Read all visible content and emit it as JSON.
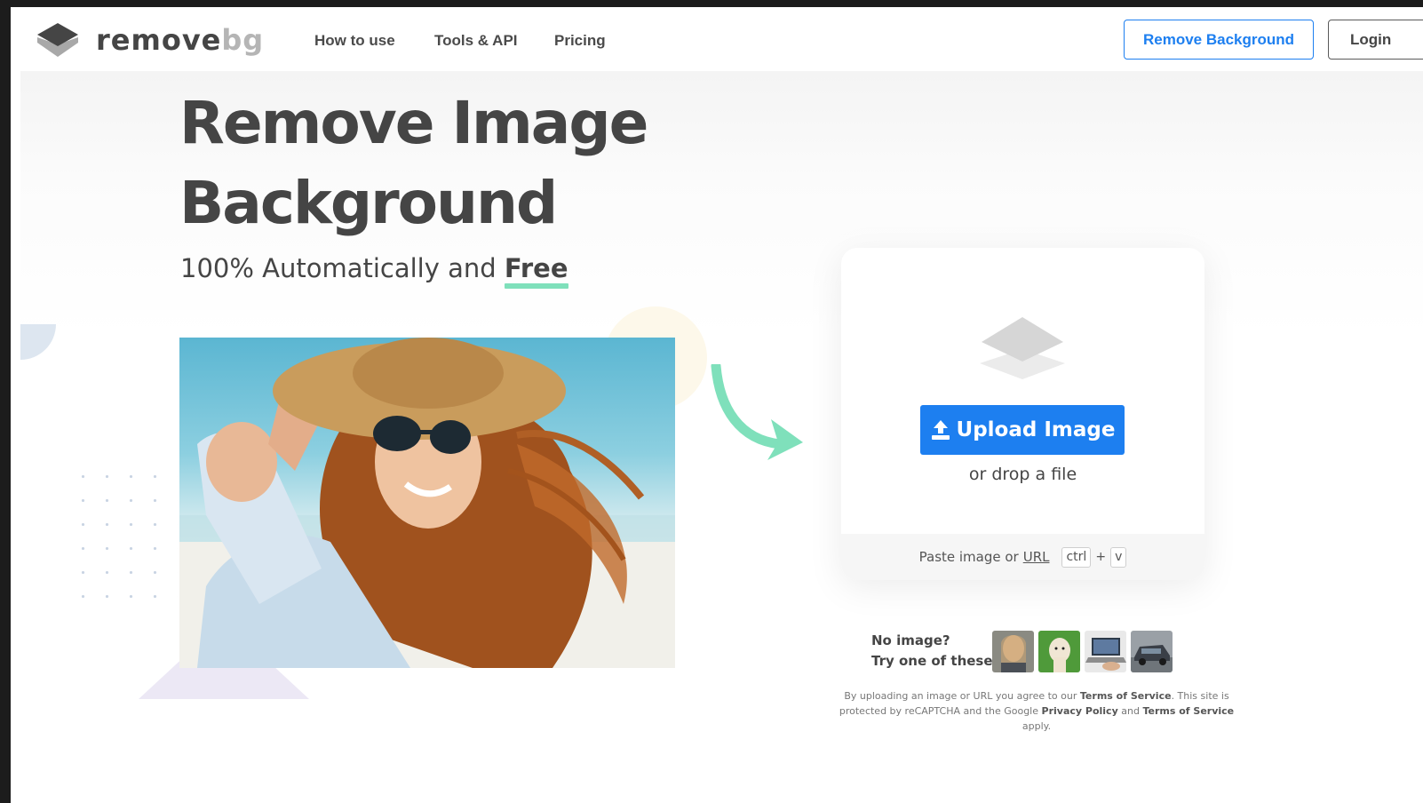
{
  "brand": {
    "name_main": "remove",
    "name_accent": "bg"
  },
  "nav": {
    "items": [
      {
        "label": "How to use"
      },
      {
        "label": "Tools & API"
      },
      {
        "label": "Pricing"
      }
    ],
    "cta_label": "Remove Background",
    "login_label": "Login"
  },
  "hero": {
    "title_line1": "Remove Image",
    "title_line2": "Background",
    "subtitle_prefix": "100% Automatically and ",
    "subtitle_emphasis": "Free"
  },
  "upload": {
    "button_label": "Upload Image",
    "drop_text": "or drop a file",
    "paste_text": "Paste image or",
    "paste_link": "URL",
    "key_ctrl": "ctrl",
    "key_plus": "+",
    "key_v": "v"
  },
  "samples": {
    "prompt_line1": "No image?",
    "prompt_line2": "Try one of these:"
  },
  "terms": {
    "part1": "By uploading an image or URL you agree to our ",
    "tos_link1": "Terms of Service",
    "part2": ". This site is protected by reCAPTCHA and the Google ",
    "privacy_link": "Privacy Policy",
    "part3": " and ",
    "tos_link2": "Terms of Service",
    "part4": " apply."
  },
  "colors": {
    "accent_blue": "#1d7ff0",
    "text_dark": "#454545",
    "highlight_green": "#7fe0bb"
  }
}
